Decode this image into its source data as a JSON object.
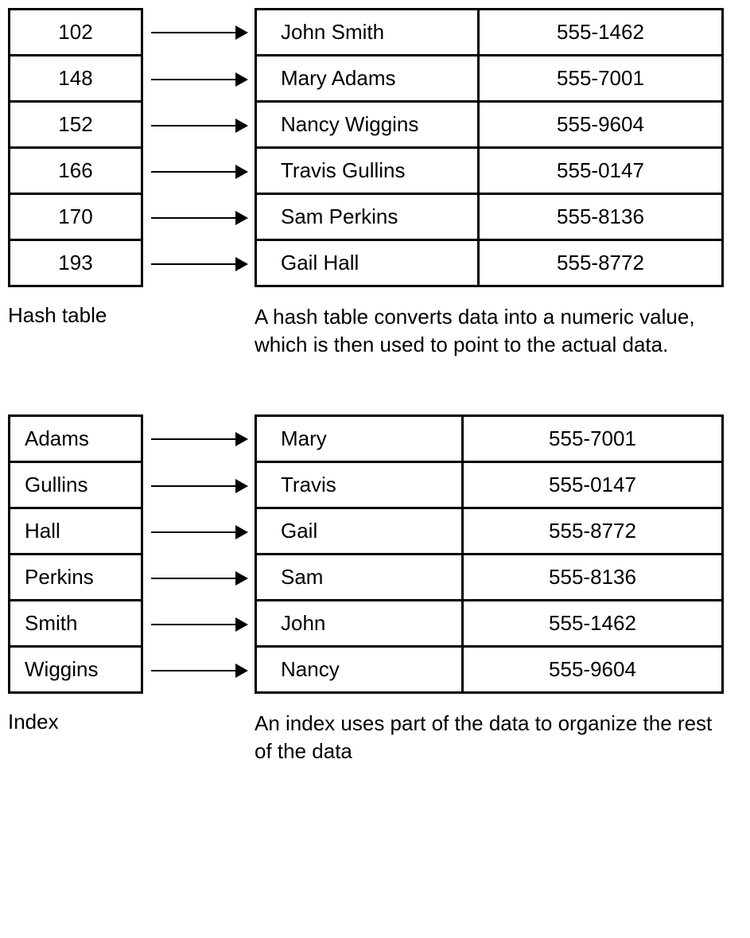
{
  "hash": {
    "label": "Hash table",
    "caption": "A hash table converts data into a numeric value, which is then used to point to the actual data.",
    "rows": [
      {
        "key": "102",
        "name": "John Smith",
        "phone": "555-1462"
      },
      {
        "key": "148",
        "name": "Mary Adams",
        "phone": "555-7001"
      },
      {
        "key": "152",
        "name": "Nancy Wiggins",
        "phone": "555-9604"
      },
      {
        "key": "166",
        "name": "Travis Gullins",
        "phone": "555-0147"
      },
      {
        "key": "170",
        "name": "Sam Perkins",
        "phone": "555-8136"
      },
      {
        "key": "193",
        "name": "Gail Hall",
        "phone": "555-8772"
      }
    ]
  },
  "index": {
    "label": "Index",
    "caption": "An index uses part of the data to organize the rest of the data",
    "rows": [
      {
        "key": "Adams",
        "name": "Mary",
        "phone": "555-7001"
      },
      {
        "key": "Gullins",
        "name": "Travis",
        "phone": "555-0147"
      },
      {
        "key": "Hall",
        "name": "Gail",
        "phone": "555-8772"
      },
      {
        "key": "Perkins",
        "name": "Sam",
        "phone": "555-8136"
      },
      {
        "key": "Smith",
        "name": "John",
        "phone": "555-1462"
      },
      {
        "key": "Wiggins",
        "name": "Nancy",
        "phone": "555-9604"
      }
    ]
  }
}
